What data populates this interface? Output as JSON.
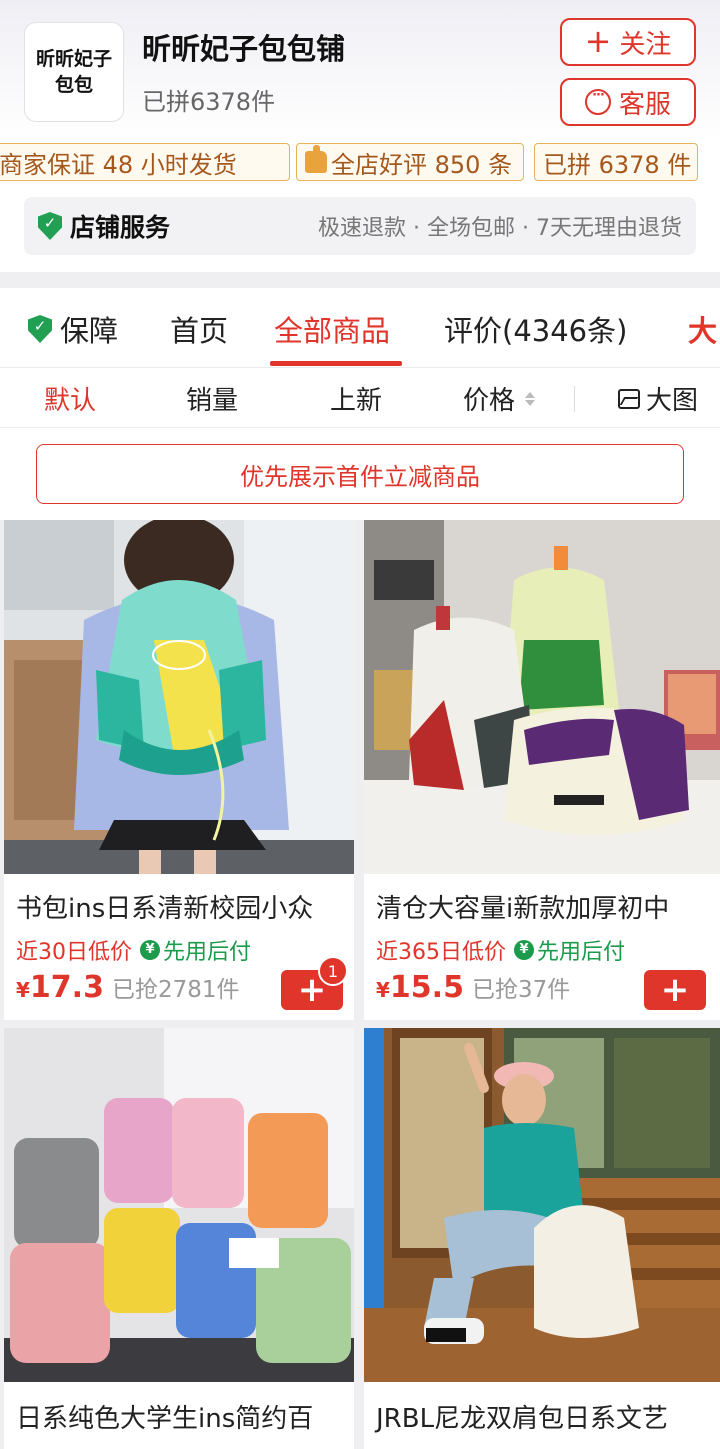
{
  "store": {
    "logo_text": "昕昕妃子包包",
    "name": "昕昕妃子包包铺",
    "sales": "已拼6378件",
    "follow_label": "关注",
    "service_label": "客服"
  },
  "badges": [
    "商家保证 48 小时发货",
    "全店好评 850 条",
    "已拼 6378 件"
  ],
  "store_service": {
    "title": "店铺服务",
    "items": "极速退款 · 全场包邮 · 7天无理由退货"
  },
  "tabs": {
    "guarantee": "保障",
    "home": "首页",
    "all_products": "全部商品",
    "reviews": "评价(4346条)",
    "more": "大"
  },
  "sort": {
    "default": "默认",
    "sales": "销量",
    "new": "上新",
    "price": "价格",
    "big_view": "大图"
  },
  "promo": "优先展示首件立减商品",
  "products": [
    {
      "title": "书包ins日系清新校园小众",
      "low_price_tag": "近30日低价",
      "pay_after": "先用后付",
      "currency": "¥",
      "price": "17.3",
      "sold": "已抢2781件",
      "cart_count": "1"
    },
    {
      "title": "清仓大容量i新款加厚初中",
      "low_price_tag": "近365日低价",
      "pay_after": "先用后付",
      "currency": "¥",
      "price": "15.5",
      "sold": "已抢37件"
    },
    {
      "title": "日系纯色大学生ins简约百"
    },
    {
      "title": "JRBL尼龙双肩包日系文艺"
    }
  ],
  "colors": {
    "accent": "#e0352b",
    "green": "#1d9b4c",
    "badge_border": "#e5b35a"
  }
}
